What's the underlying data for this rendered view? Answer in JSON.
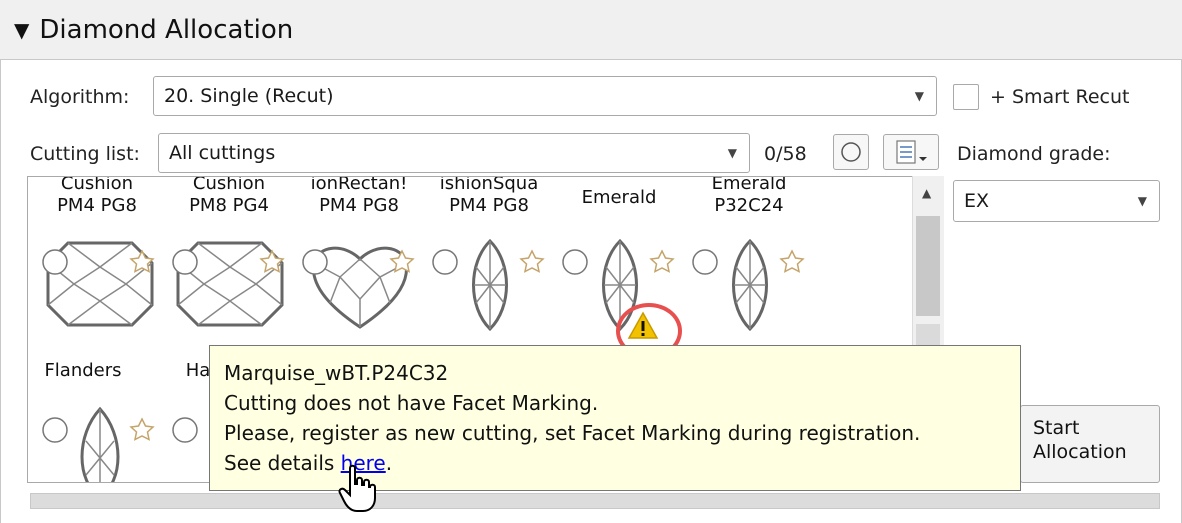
{
  "panel": {
    "title": "Diamond Allocation"
  },
  "algorithm": {
    "label": "Algorithm:",
    "value": "20. Single (Recut)"
  },
  "smart_recut": {
    "label": "+ Smart Recut",
    "checked": false
  },
  "cutting_list": {
    "label": "Cutting list:",
    "value": "All cuttings",
    "count": "0/58"
  },
  "diamond_grade": {
    "label": "Diamond grade:",
    "value": "EX"
  },
  "cuttings_row1": [
    {
      "line1": "Cushion",
      "line2": "PM4 PG8",
      "shape": "cushion"
    },
    {
      "line1": "Cushion",
      "line2": "PM8 PG4",
      "shape": "cushion"
    },
    {
      "line1": "ionRectan!",
      "line2": "PM4 PG8",
      "shape": "heart"
    },
    {
      "line1": "ishionSqua",
      "line2": "PM4 PG8",
      "shape": "marquise"
    },
    {
      "line1": "Emerald",
      "line2": "",
      "shape": "marquise"
    },
    {
      "line1": "Emerald",
      "line2": "P32C24",
      "shape": "marquise"
    }
  ],
  "cuttings_row2": [
    {
      "line1": "Flanders",
      "shape": "pear"
    },
    {
      "line1": "Ha",
      "shape": "pear"
    }
  ],
  "start_button": {
    "line1": "Start",
    "line2": "Allocation"
  },
  "tooltip": {
    "line1": "Marquise_wBT.P24C32",
    "line2": "Cutting does not have Facet Marking.",
    "line3": "Please, register as new cutting, set Facet Marking during registration.",
    "line4_prefix": "See details ",
    "link": "here",
    "line4_suffix": "."
  },
  "colors": {
    "tooltip_bg": "#ffffe1",
    "warning": "#f2c200",
    "highlight_ring": "#e8504f",
    "link": "#0000ee"
  }
}
